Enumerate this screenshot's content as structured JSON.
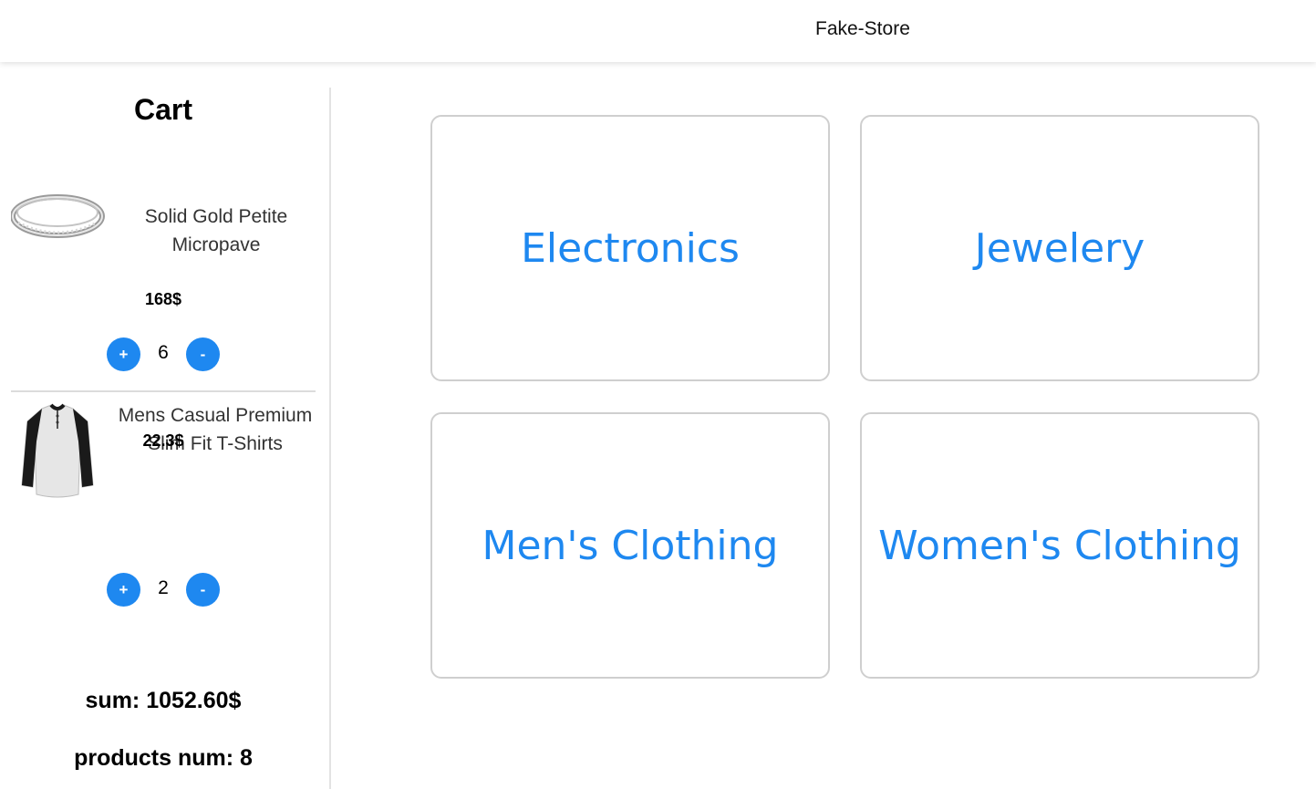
{
  "header": {
    "brand": "Fake-Store"
  },
  "cart": {
    "title": "Cart",
    "items": [
      {
        "name": "Solid Gold Petite Micropave",
        "price": "168$",
        "quantity": "6",
        "plus_label": "+",
        "minus_label": "-",
        "icon": "ring-image"
      },
      {
        "name": "Mens Casual Premium Slim Fit T-Shirts",
        "price": "22.3$",
        "quantity": "2",
        "plus_label": "+",
        "minus_label": "-",
        "icon": "tshirt-image"
      }
    ],
    "sum_label": "sum: 1052.60$",
    "products_num_label": "products num: 8"
  },
  "categories": [
    {
      "label": "Electronics"
    },
    {
      "label": "Jewelery"
    },
    {
      "label": "Men's Clothing"
    },
    {
      "label": "Women's Clothing"
    }
  ],
  "colors": {
    "accent": "#1e88f0",
    "card_border": "#cfcfcf",
    "divider": "#e3e3e3"
  }
}
